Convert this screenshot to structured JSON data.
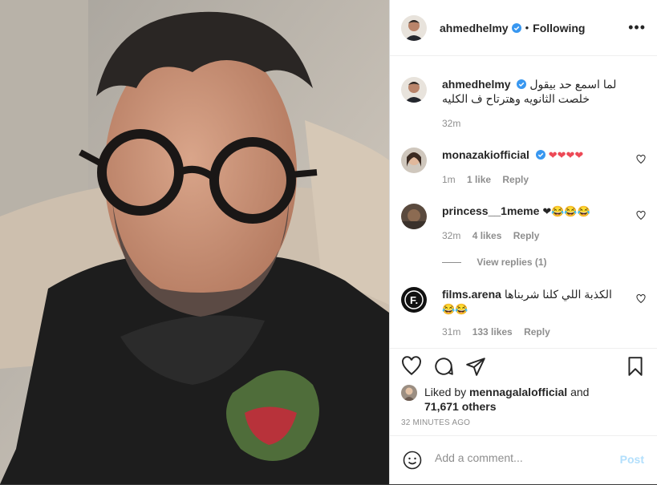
{
  "post": {
    "username": "ahmedhelmy",
    "follow_state": "Following",
    "more_icon": "more-options-icon"
  },
  "caption": {
    "username": "ahmedhelmy",
    "text": "لما اسمع حد بيقول خلصت الثانويه وهترتاح ف الكليه",
    "time": "32m"
  },
  "comments": [
    {
      "username": "monazakiofficial",
      "text": "❤❤❤❤",
      "time": "1m",
      "likes": "1 like",
      "reply": "Reply"
    },
    {
      "username": "princess__1meme",
      "text": "❤😂😂😂",
      "time": "32m",
      "likes": "4 likes",
      "reply": "Reply",
      "view_replies": "View replies (1)"
    },
    {
      "username": "films.arena",
      "text": "الكذبة اللي كلنا شربناها",
      "emoji": "😂😂",
      "time": "31m",
      "likes": "133 likes",
      "reply": "Reply"
    }
  ],
  "likes": {
    "prefix": "Liked by",
    "user": "menn­agalalofficial",
    "and": "and",
    "count": "71,671 others"
  },
  "timestamp": "32 MINUTES AGO",
  "add_comment": {
    "placeholder": "Add a comment...",
    "post_label": "Post"
  },
  "colors": {
    "verified": "#3897f0",
    "heart": "#ed4956",
    "post_disabled": "#b2dffc"
  }
}
